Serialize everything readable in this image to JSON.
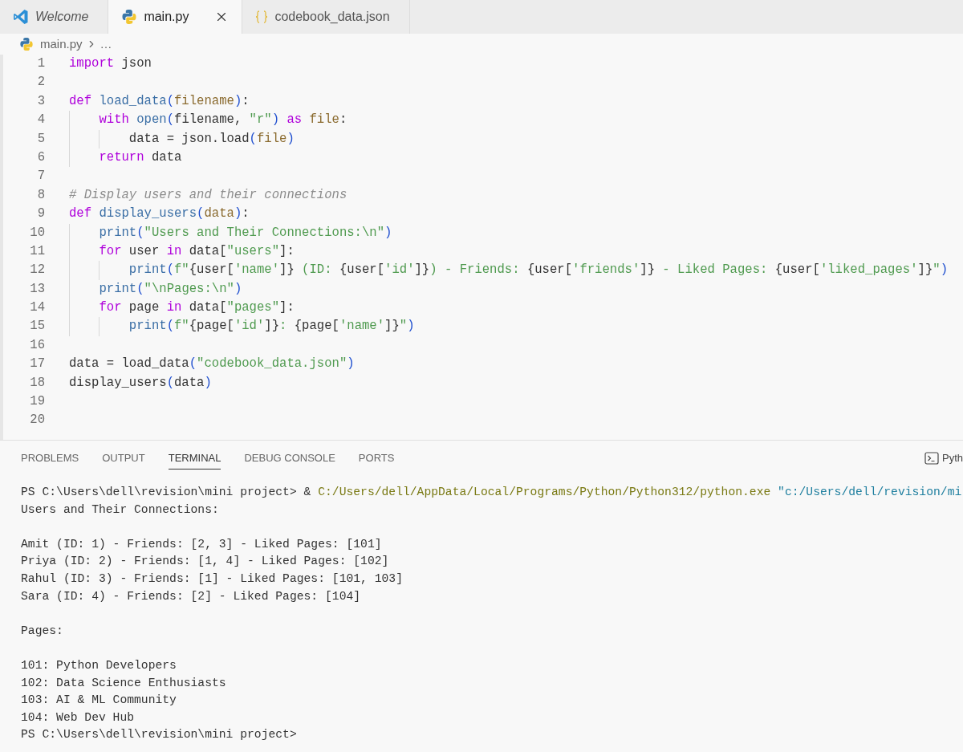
{
  "editor_tabs": [
    {
      "label": "Welcome",
      "selected": false,
      "preview": true
    },
    {
      "label": "main.py",
      "selected": true,
      "preview": false
    },
    {
      "label": "codebook_data.json",
      "selected": false,
      "preview": false
    }
  ],
  "breadcrumb": {
    "file": "main.py",
    "more": "…"
  },
  "code_lines": [
    {
      "number": "1",
      "tokens": [
        {
          "kind": "keyword",
          "text": "import"
        },
        {
          "kind": "plain",
          "text": " json"
        }
      ]
    },
    {
      "number": "2"
    },
    {
      "number": "3",
      "tokens": [
        {
          "kind": "keyword",
          "text": "def"
        },
        {
          "kind": "function",
          "text": " load_data"
        },
        {
          "kind": "paren",
          "text": "("
        },
        {
          "kind": "param",
          "text": "filename"
        },
        {
          "kind": "paren",
          "text": ")"
        },
        {
          "kind": "plain",
          "text": ":"
        }
      ]
    },
    {
      "number": "4",
      "tokens": [
        {
          "kind": "keyword",
          "text": "    with"
        },
        {
          "kind": "function",
          "text": " open"
        },
        {
          "kind": "paren",
          "text": "("
        },
        {
          "kind": "plain",
          "text": "filename, "
        },
        {
          "kind": "string",
          "text": "\"r\""
        },
        {
          "kind": "paren",
          "text": ")"
        },
        {
          "kind": "keyword",
          "text": " as"
        },
        {
          "kind": "param",
          "text": " file"
        },
        {
          "kind": "plain",
          "text": ":"
        }
      ]
    },
    {
      "number": "5",
      "tokens": [
        {
          "kind": "plain",
          "text": "        data = json.load"
        },
        {
          "kind": "paren",
          "text": "("
        },
        {
          "kind": "param",
          "text": "file"
        },
        {
          "kind": "paren",
          "text": ")"
        }
      ]
    },
    {
      "number": "6",
      "tokens": [
        {
          "kind": "keyword",
          "text": "    return"
        },
        {
          "kind": "plain",
          "text": " data"
        }
      ]
    },
    {
      "number": "7"
    },
    {
      "number": "8",
      "tokens": [
        {
          "kind": "comment",
          "text": "# Display users and their connections"
        }
      ]
    },
    {
      "number": "9",
      "tokens": [
        {
          "kind": "keyword",
          "text": "def"
        },
        {
          "kind": "function",
          "text": " display_users"
        },
        {
          "kind": "paren",
          "text": "("
        },
        {
          "kind": "param",
          "text": "data"
        },
        {
          "kind": "paren",
          "text": ")"
        },
        {
          "kind": "plain",
          "text": ":"
        }
      ]
    },
    {
      "number": "10",
      "tokens": [
        {
          "kind": "function",
          "text": "    print"
        },
        {
          "kind": "paren",
          "text": "("
        },
        {
          "kind": "string",
          "text": "\"Users and Their Connections:\\n\""
        },
        {
          "kind": "paren",
          "text": ")"
        }
      ]
    },
    {
      "number": "11",
      "tokens": [
        {
          "kind": "keyword",
          "text": "    for"
        },
        {
          "kind": "plain",
          "text": " user "
        },
        {
          "kind": "keyword",
          "text": "in"
        },
        {
          "kind": "plain",
          "text": " data["
        },
        {
          "kind": "string",
          "text": "\"users\""
        },
        {
          "kind": "plain",
          "text": "]:"
        }
      ]
    },
    {
      "number": "12",
      "tokens": [
        {
          "kind": "function",
          "text": "        print"
        },
        {
          "kind": "paren",
          "text": "("
        },
        {
          "kind": "string",
          "text": "f\""
        },
        {
          "kind": "plain",
          "text": "{user["
        },
        {
          "kind": "string",
          "text": "'name'"
        },
        {
          "kind": "plain",
          "text": "]}"
        },
        {
          "kind": "string",
          "text": " (ID: "
        },
        {
          "kind": "plain",
          "text": "{user["
        },
        {
          "kind": "string",
          "text": "'id'"
        },
        {
          "kind": "plain",
          "text": "]}"
        },
        {
          "kind": "string",
          "text": ") - Friends: "
        },
        {
          "kind": "plain",
          "text": "{user["
        },
        {
          "kind": "string",
          "text": "'friends'"
        },
        {
          "kind": "plain",
          "text": "]}"
        },
        {
          "kind": "string",
          "text": " - Liked Pages: "
        },
        {
          "kind": "plain",
          "text": "{user["
        },
        {
          "kind": "string",
          "text": "'liked_pages'"
        },
        {
          "kind": "plain",
          "text": "]}"
        },
        {
          "kind": "string",
          "text": "\""
        },
        {
          "kind": "paren",
          "text": ")"
        }
      ]
    },
    {
      "number": "13",
      "tokens": [
        {
          "kind": "function",
          "text": "    print"
        },
        {
          "kind": "paren",
          "text": "("
        },
        {
          "kind": "string",
          "text": "\"\\nPages:\\n\""
        },
        {
          "kind": "paren",
          "text": ")"
        }
      ]
    },
    {
      "number": "14",
      "tokens": [
        {
          "kind": "keyword",
          "text": "    for"
        },
        {
          "kind": "plain",
          "text": " page "
        },
        {
          "kind": "keyword",
          "text": "in"
        },
        {
          "kind": "plain",
          "text": " data["
        },
        {
          "kind": "string",
          "text": "\"pages\""
        },
        {
          "kind": "plain",
          "text": "]:"
        }
      ]
    },
    {
      "number": "15",
      "tokens": [
        {
          "kind": "function",
          "text": "        print"
        },
        {
          "kind": "paren",
          "text": "("
        },
        {
          "kind": "string",
          "text": "f\""
        },
        {
          "kind": "plain",
          "text": "{page["
        },
        {
          "kind": "string",
          "text": "'id'"
        },
        {
          "kind": "plain",
          "text": "]}"
        },
        {
          "kind": "string",
          "text": ": "
        },
        {
          "kind": "plain",
          "text": "{page["
        },
        {
          "kind": "string",
          "text": "'name'"
        },
        {
          "kind": "plain",
          "text": "]}"
        },
        {
          "kind": "string",
          "text": "\""
        },
        {
          "kind": "paren",
          "text": ")"
        }
      ]
    },
    {
      "number": "16"
    },
    {
      "number": "17",
      "tokens": [
        {
          "kind": "plain",
          "text": "data = load_data"
        },
        {
          "kind": "paren",
          "text": "("
        },
        {
          "kind": "string",
          "text": "\"codebook_data.json\""
        },
        {
          "kind": "paren",
          "text": ")"
        }
      ]
    },
    {
      "number": "18",
      "tokens": [
        {
          "kind": "plain",
          "text": "display_users"
        },
        {
          "kind": "paren",
          "text": "("
        },
        {
          "kind": "plain",
          "text": "data"
        },
        {
          "kind": "paren",
          "text": ")"
        }
      ]
    },
    {
      "number": "19"
    },
    {
      "number": "20"
    }
  ],
  "panel_tabs": [
    {
      "label": "PROBLEMS",
      "selected": false
    },
    {
      "label": "OUTPUT",
      "selected": false
    },
    {
      "label": "TERMINAL",
      "selected": true
    },
    {
      "label": "DEBUG CONSOLE",
      "selected": false
    },
    {
      "label": "PORTS",
      "selected": false
    }
  ],
  "terminal_profile": "Pyth",
  "terminal_lines": [
    {
      "kind": "text",
      "segments": [
        {
          "kind": "plain",
          "text": "PS C:\\Users\\dell\\revision\\mini project> & "
        },
        {
          "kind": "path",
          "text": "C:/Users/dell/AppData/Local/Programs/Python/Python312/python.exe"
        },
        {
          "kind": "string",
          "text": " \"c:/Users/dell/revision/mi"
        }
      ]
    },
    {
      "kind": "text",
      "segments": [
        {
          "kind": "plain",
          "text": "Users and Their Connections:"
        }
      ]
    },
    {
      "kind": "blank"
    },
    {
      "kind": "text",
      "segments": [
        {
          "kind": "plain",
          "text": "Amit (ID: 1) - Friends: [2, 3] - Liked Pages: [101]"
        }
      ]
    },
    {
      "kind": "text",
      "segments": [
        {
          "kind": "plain",
          "text": "Priya (ID: 2) - Friends: [1, 4] - Liked Pages: [102]"
        }
      ]
    },
    {
      "kind": "text",
      "segments": [
        {
          "kind": "plain",
          "text": "Rahul (ID: 3) - Friends: [1] - Liked Pages: [101, 103]"
        }
      ]
    },
    {
      "kind": "text",
      "segments": [
        {
          "kind": "plain",
          "text": "Sara (ID: 4) - Friends: [2] - Liked Pages: [104]"
        }
      ]
    },
    {
      "kind": "blank"
    },
    {
      "kind": "text",
      "segments": [
        {
          "kind": "plain",
          "text": "Pages:"
        }
      ]
    },
    {
      "kind": "blank"
    },
    {
      "kind": "text",
      "segments": [
        {
          "kind": "plain",
          "text": "101: Python Developers"
        }
      ]
    },
    {
      "kind": "text",
      "segments": [
        {
          "kind": "plain",
          "text": "102: Data Science Enthusiasts"
        }
      ]
    },
    {
      "kind": "text",
      "segments": [
        {
          "kind": "plain",
          "text": "103: AI & ML Community"
        }
      ]
    },
    {
      "kind": "text",
      "segments": [
        {
          "kind": "plain",
          "text": "104: Web Dev Hub"
        }
      ]
    },
    {
      "kind": "text",
      "segments": [
        {
          "kind": "plain",
          "text": "PS C:\\Users\\dell\\revision\\mini project>"
        }
      ]
    }
  ]
}
